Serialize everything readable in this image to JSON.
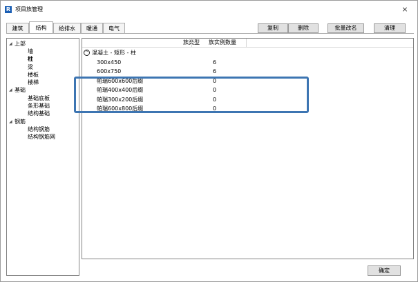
{
  "window": {
    "title": "项目族管理",
    "logo_letter": "R",
    "close_glyph": "×",
    "logo_color": "#1b5fb4"
  },
  "tabs": [
    {
      "label": "建筑",
      "active": false
    },
    {
      "label": "结构",
      "active": true
    },
    {
      "label": "给排水",
      "active": false
    },
    {
      "label": "暖通",
      "active": false
    },
    {
      "label": "电气",
      "active": false
    }
  ],
  "toolbar": {
    "copy_label": "复制",
    "delete_label": "删除",
    "batch_rename_label": "批量改名",
    "clean_label": "清理"
  },
  "tree": [
    {
      "label": "上部",
      "level": 0,
      "expanded": true
    },
    {
      "label": "墙",
      "level": 1
    },
    {
      "label": "柱",
      "level": 1,
      "selected": true
    },
    {
      "label": "梁",
      "level": 1
    },
    {
      "label": "楼板",
      "level": 1
    },
    {
      "label": "楼梯",
      "level": 1
    },
    {
      "label": "基础",
      "level": 0,
      "expanded": true
    },
    {
      "label": "基础底板",
      "level": 1
    },
    {
      "label": "条形基础",
      "level": 1
    },
    {
      "label": "结构基础",
      "level": 1
    },
    {
      "label": "钢筋",
      "level": 0,
      "expanded": true
    },
    {
      "label": "结构钢筋",
      "level": 1
    },
    {
      "label": "结构钢筋网",
      "level": 1
    }
  ],
  "grid": {
    "columns": [
      "族类型",
      "族实例数量"
    ],
    "group": {
      "label": "混凝土 - 矩形 - 柱",
      "toggle_glyph": "^",
      "rows": [
        {
          "name": "300x450",
          "count": "6"
        },
        {
          "name": "600x750",
          "count": "6"
        },
        {
          "name": "帕瑞600x600后缀",
          "count": "0"
        },
        {
          "name": "帕瑞400x400后缀",
          "count": "0"
        },
        {
          "name": "帕瑞300x200后缀",
          "count": "0"
        },
        {
          "name": "帕瑞600x800后缀",
          "count": "0"
        }
      ]
    },
    "highlight_color": "#3d75b2"
  },
  "footer": {
    "ok_label": "确定"
  }
}
